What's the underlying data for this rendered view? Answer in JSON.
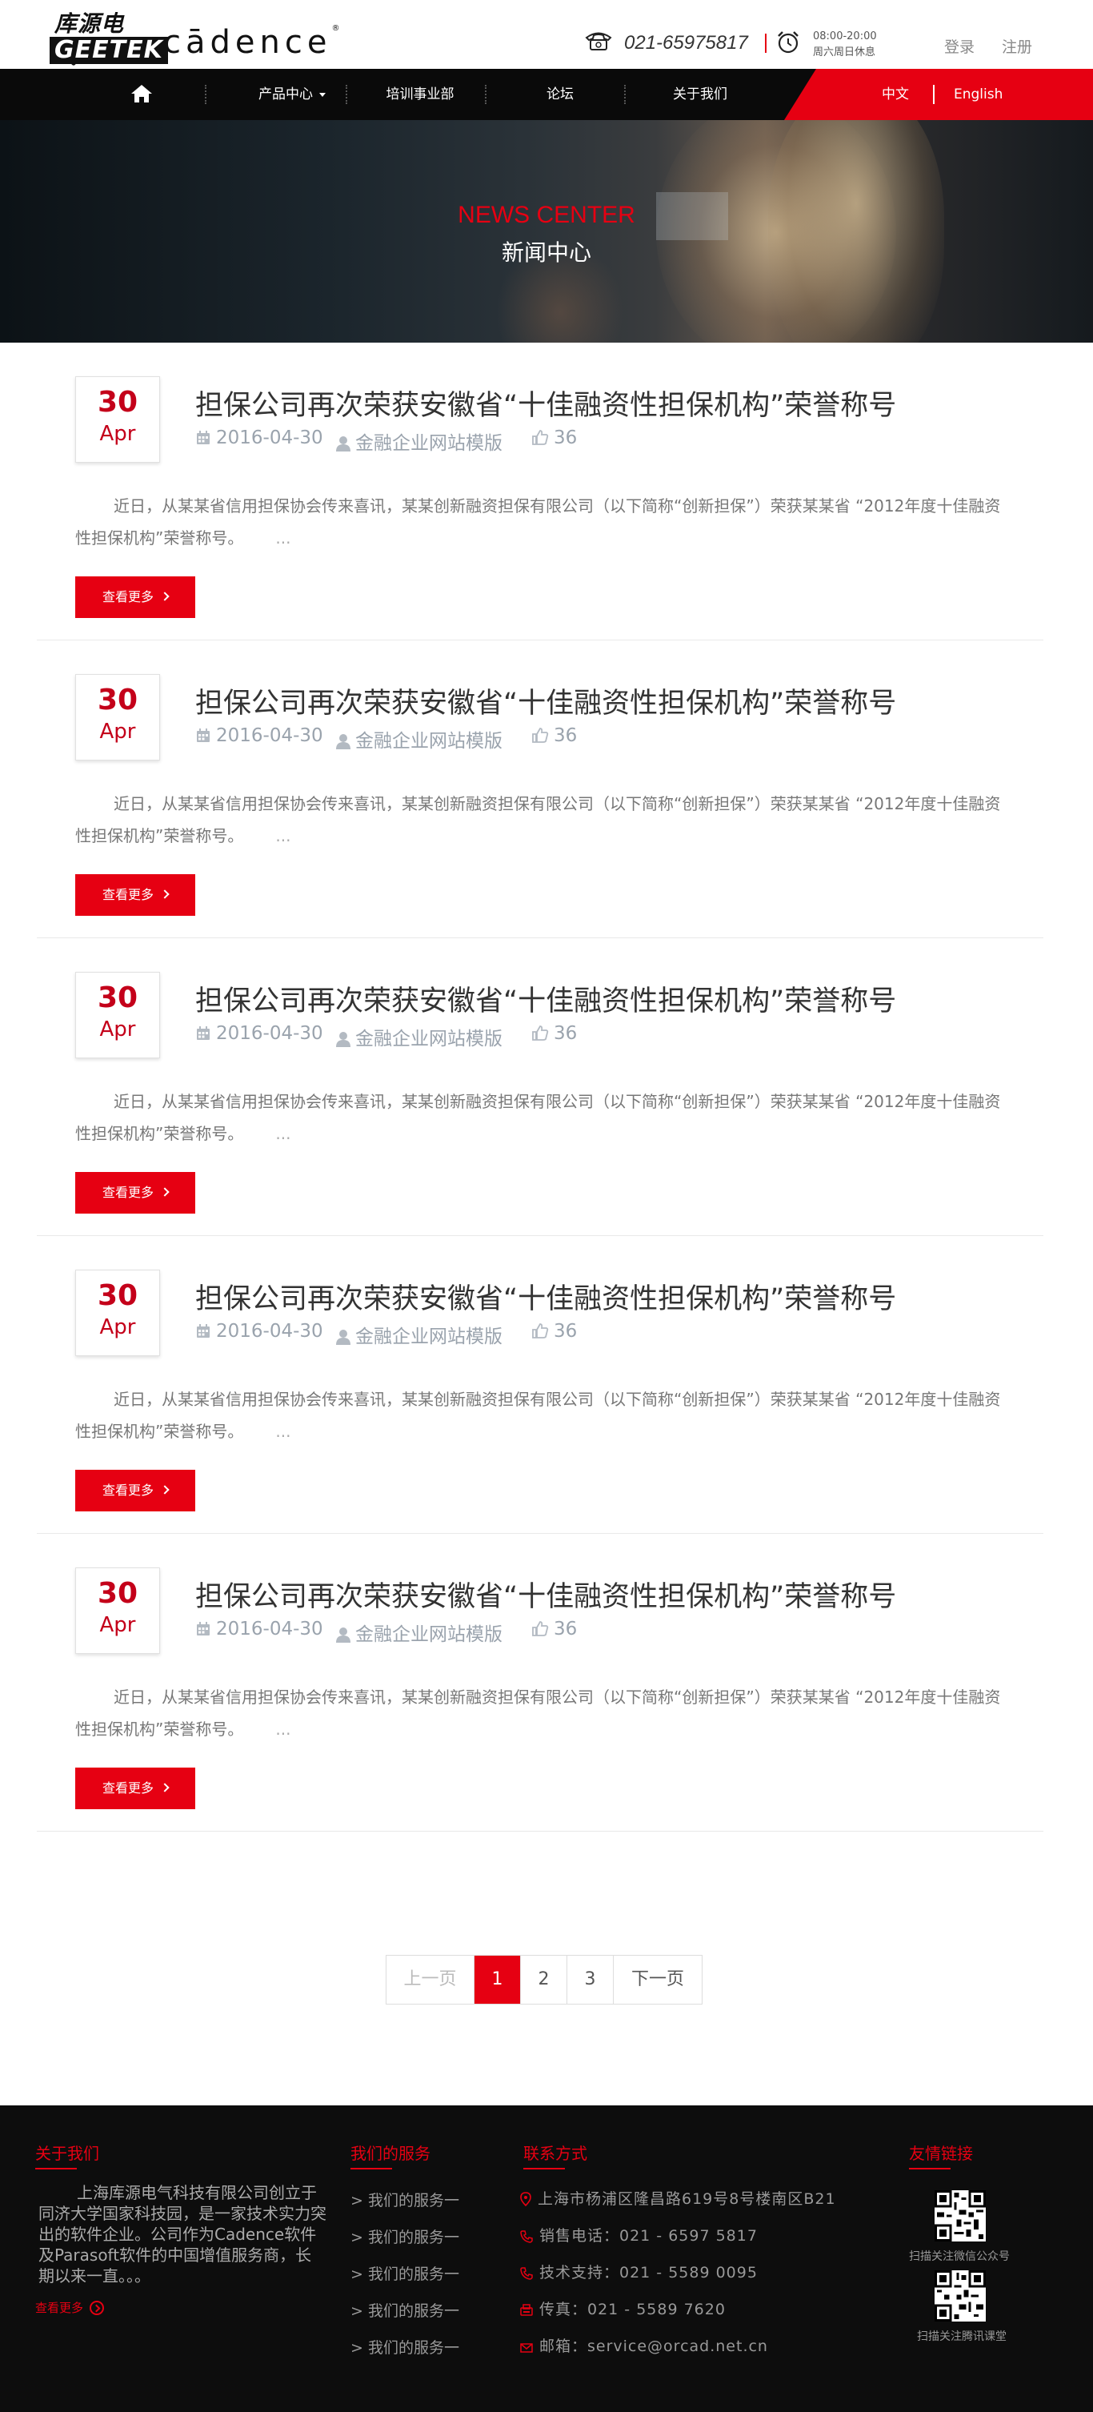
{
  "header": {
    "logo_cn": "库源电气",
    "logo_en": "GEETEK",
    "logo_cadence": "cādence",
    "phone": "021-65975817",
    "hours_line1": "08:00-20:00",
    "hours_line2": "周六周日休息",
    "login": "登录",
    "register": "注册"
  },
  "nav": {
    "items": [
      {
        "label": "产品中心"
      },
      {
        "label": "培训事业部"
      },
      {
        "label": "论坛"
      },
      {
        "label": "关于我们"
      }
    ],
    "lang_cn": "中文",
    "lang_en": "English"
  },
  "banner": {
    "title_en": "NEWS CENTER",
    "title_cn": "新闻中心"
  },
  "news": [
    {
      "day": "30",
      "month": "Apr",
      "title": "担保公司再次荣获安徽省“十佳融资性担保机构”荣誉称号",
      "date": "2016-04-30",
      "category": "金融企业网站模版",
      "views": "36",
      "excerpt": "近日，从某某省信用担保协会传来喜讯，某某创新融资担保有限公司（以下简称“创新担保”）荣获某某省 “2012年度十佳融资性担保机构”荣誉称号。",
      "ellipsis": "...",
      "more": "查看更多"
    },
    {
      "day": "30",
      "month": "Apr",
      "title": "担保公司再次荣获安徽省“十佳融资性担保机构”荣誉称号",
      "date": "2016-04-30",
      "category": "金融企业网站模版",
      "views": "36",
      "excerpt": "近日，从某某省信用担保协会传来喜讯，某某创新融资担保有限公司（以下简称“创新担保”）荣获某某省 “2012年度十佳融资性担保机构”荣誉称号。",
      "ellipsis": "...",
      "more": "查看更多"
    },
    {
      "day": "30",
      "month": "Apr",
      "title": "担保公司再次荣获安徽省“十佳融资性担保机构”荣誉称号",
      "date": "2016-04-30",
      "category": "金融企业网站模版",
      "views": "36",
      "excerpt": "近日，从某某省信用担保协会传来喜讯，某某创新融资担保有限公司（以下简称“创新担保”）荣获某某省 “2012年度十佳融资性担保机构”荣誉称号。",
      "ellipsis": "...",
      "more": "查看更多"
    },
    {
      "day": "30",
      "month": "Apr",
      "title": "担保公司再次荣获安徽省“十佳融资性担保机构”荣誉称号",
      "date": "2016-04-30",
      "category": "金融企业网站模版",
      "views": "36",
      "excerpt": "近日，从某某省信用担保协会传来喜讯，某某创新融资担保有限公司（以下简称“创新担保”）荣获某某省 “2012年度十佳融资性担保机构”荣誉称号。",
      "ellipsis": "...",
      "more": "查看更多"
    },
    {
      "day": "30",
      "month": "Apr",
      "title": "担保公司再次荣获安徽省“十佳融资性担保机构”荣誉称号",
      "date": "2016-04-30",
      "category": "金融企业网站模版",
      "views": "36",
      "excerpt": "近日，从某某省信用担保协会传来喜讯，某某创新融资担保有限公司（以下简称“创新担保”）荣获某某省 “2012年度十佳融资性担保机构”荣誉称号。",
      "ellipsis": "...",
      "more": "查看更多"
    }
  ],
  "pagination": {
    "prev": "上一页",
    "pages": [
      "1",
      "2",
      "3"
    ],
    "current": "1",
    "next": "下一页"
  },
  "footer": {
    "about": {
      "heading": "关于我们",
      "text": "上海库源电气科技有限公司创立于同济大学国家科技园，是一家技术实力突出的软件企业。公司作为Cadence软件及Parasoft软件的中国增值服务商，长期以来一直。。。",
      "more": "查看更多"
    },
    "services": {
      "heading": "我们的服务",
      "items": [
        "> 我们的服务一",
        "> 我们的服务一",
        "> 我们的服务一",
        "> 我们的服务一",
        "> 我们的服务一"
      ]
    },
    "contact": {
      "heading": "联系方式",
      "address": "上海市杨浦区隆昌路619号8号楼南区B21",
      "sales": "销售电话：021 - 6597 5817",
      "support": "技术支持：021 - 5589 0095",
      "fax": "传真：021 - 5589 7620",
      "email": "邮箱：service@orcad.net.cn"
    },
    "links": {
      "heading": "友情链接",
      "qr1_caption": "扫描关注微信公众号",
      "qr2_caption": "扫描关注腾讯课堂"
    }
  },
  "colors": {
    "accent": "#e60012",
    "nav_bg": "#0a0a0a",
    "footer_bg": "#0d0d0d",
    "date_red": "#c4001a"
  }
}
